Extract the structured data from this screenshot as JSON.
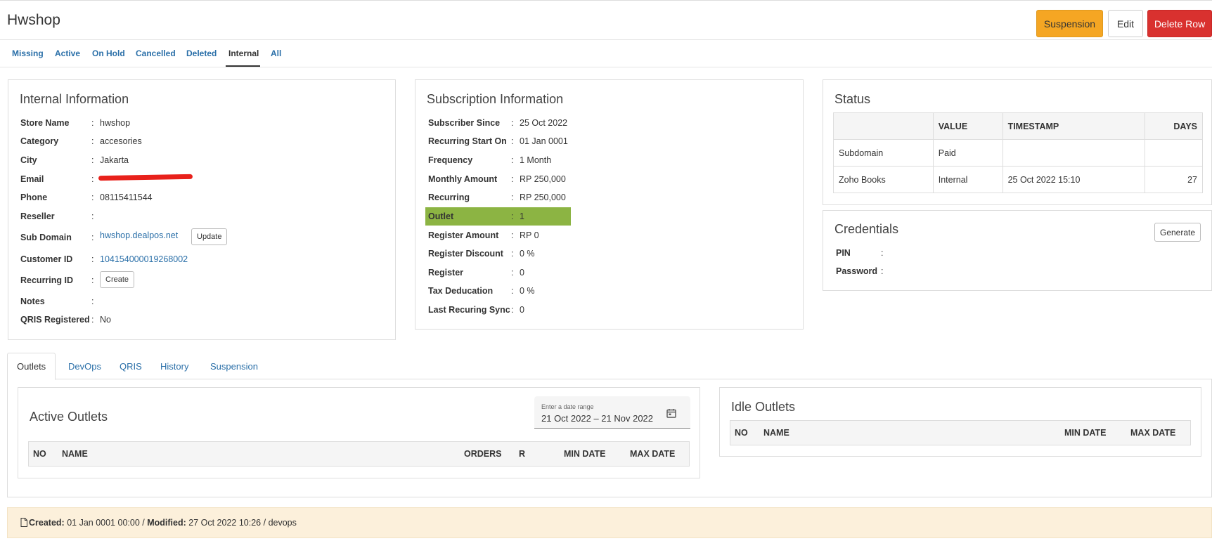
{
  "page": {
    "title": "Hwshop"
  },
  "actions": {
    "suspension": "Suspension",
    "edit": "Edit",
    "delete": "Delete Row"
  },
  "status_tabs": [
    "Missing",
    "Active",
    "On Hold",
    "Cancelled",
    "Deleted",
    "Internal",
    "All"
  ],
  "active_status_tab": "Internal",
  "internal": {
    "title": "Internal Information",
    "rows": [
      {
        "label": "Store Name",
        "value": "hwshop"
      },
      {
        "label": "Category",
        "value": "accesories"
      },
      {
        "label": "City",
        "value": "Jakarta"
      },
      {
        "label": "Email",
        "value": ""
      },
      {
        "label": "Phone",
        "value": "08115411544"
      },
      {
        "label": "Reseller",
        "value": ""
      },
      {
        "label": "Sub Domain",
        "value": "hwshop.dealpos.net"
      },
      {
        "label": "Customer ID",
        "value": "104154000019268002"
      },
      {
        "label": "Recurring ID",
        "value": ""
      },
      {
        "label": "Notes",
        "value": ""
      },
      {
        "label": "QRIS Registered",
        "value": "No"
      }
    ],
    "update_button": "Update",
    "create_button": "Create"
  },
  "subscription": {
    "title": "Subscription Information",
    "rows": [
      {
        "label": "Subscriber Since",
        "value": "25 Oct 2022"
      },
      {
        "label": "Recurring Start On",
        "value": "01 Jan 0001"
      },
      {
        "label": "Frequency",
        "value": "1 Month"
      },
      {
        "label": "Monthly Amount",
        "value": "RP 250,000"
      },
      {
        "label": "Recurring",
        "value": "RP 250,000"
      },
      {
        "label": "Outlet",
        "value": "1"
      },
      {
        "label": "Register Amount",
        "value": "RP 0"
      },
      {
        "label": "Register Discount",
        "value": "0 %"
      },
      {
        "label": "Register",
        "value": "0"
      },
      {
        "label": "Tax Deducation",
        "value": "0 %"
      },
      {
        "label": "Last Recuring Sync",
        "value": "0"
      }
    ],
    "highlight_color": "#8cb443"
  },
  "status": {
    "title": "Status",
    "headers": [
      "",
      "VALUE",
      "TIMESTAMP",
      "DAYS"
    ],
    "rows": [
      {
        "name": "Subdomain",
        "value": "Paid",
        "timestamp": "",
        "days": ""
      },
      {
        "name": "Zoho Books",
        "value": "Internal",
        "timestamp": "25 Oct 2022 15:10",
        "days": "27"
      }
    ]
  },
  "credentials": {
    "title": "Credentials",
    "generate_button": "Generate",
    "pin_label": "PIN",
    "password_label": "Password",
    "pin_value": "",
    "password_value": ""
  },
  "section_tabs": [
    "Outlets",
    "DevOps",
    "QRIS",
    "History",
    "Suspension"
  ],
  "active_outlets": {
    "title": "Active Outlets",
    "date_label": "Enter a date range",
    "date_value": "21 Oct 2022 – 21 Nov 2022",
    "columns": [
      "NO",
      "NAME",
      "ORDERS",
      "R",
      "MIN DATE",
      "MAX DATE"
    ]
  },
  "idle_outlets": {
    "title": "Idle Outlets",
    "columns": [
      "NO",
      "NAME",
      "MIN DATE",
      "MAX DATE"
    ]
  },
  "footer": {
    "created_label": "Created:",
    "created_value": "01 Jan 0001 00:00",
    "sep1": "/",
    "modified_label": "Modified:",
    "modified_value": "27 Oct 2022 10:26",
    "sep2": "/",
    "modified_by": "devops"
  },
  "colors": {
    "suspension_button": "#f5a623",
    "delete_button": "#d9312f",
    "link": "#2a6fa8",
    "footer_bg": "#fcf0db"
  }
}
